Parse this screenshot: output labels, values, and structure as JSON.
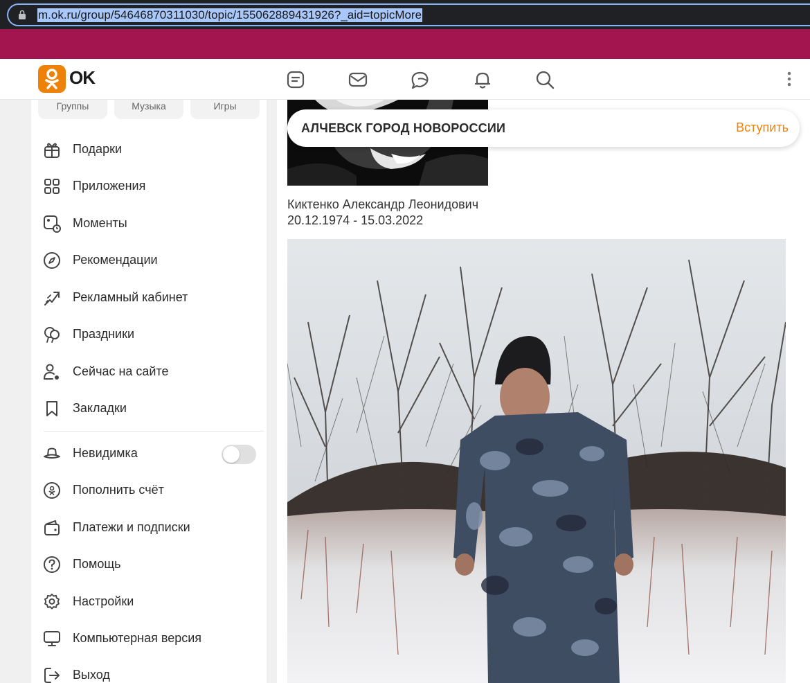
{
  "browser": {
    "url": "m.ok.ru/group/54646870311030/topic/155062889431926?_aid=topicMore"
  },
  "header": {
    "logo_text": "OK",
    "icons": [
      "feed-icon",
      "messages-icon",
      "discussions-icon",
      "notifications-icon",
      "search-icon",
      "more-icon"
    ]
  },
  "sidebar": {
    "pills": [
      "Группы",
      "Музыка",
      "Игры"
    ],
    "items": [
      {
        "label": "Подарки",
        "icon": "gift-icon"
      },
      {
        "label": "Приложения",
        "icon": "apps-icon"
      },
      {
        "label": "Моменты",
        "icon": "moments-icon"
      },
      {
        "label": "Рекомендации",
        "icon": "compass-icon"
      },
      {
        "label": "Рекламный кабинет",
        "icon": "ads-icon"
      },
      {
        "label": "Праздники",
        "icon": "balloons-icon"
      },
      {
        "label": "Сейчас на сайте",
        "icon": "online-user-icon"
      },
      {
        "label": "Закладки",
        "icon": "bookmark-icon"
      },
      {
        "label": "Невидимка",
        "icon": "hat-icon"
      },
      {
        "label": "Пополнить счёт",
        "icon": "ok-coin-icon"
      },
      {
        "label": "Платежи и подписки",
        "icon": "wallet-icon"
      },
      {
        "label": "Помощь",
        "icon": "help-icon"
      },
      {
        "label": "Настройки",
        "icon": "settings-icon"
      },
      {
        "label": "Компьютерная версия",
        "icon": "desktop-icon"
      },
      {
        "label": "Выход",
        "icon": "logout-icon"
      }
    ],
    "invisible_toggle": "off"
  },
  "group": {
    "name": "АЛЧЕВСК ГОРОД НОВОРОССИИ",
    "join_label": "Вступить"
  },
  "post": {
    "caption_name": "Киктенко Александр Леонидович",
    "caption_dates": "20.12.1974 - 15.03.2022"
  },
  "colors": {
    "brand": "#ee8208",
    "header_band": "#a3154f",
    "url_highlight": "#a8c7fa"
  }
}
